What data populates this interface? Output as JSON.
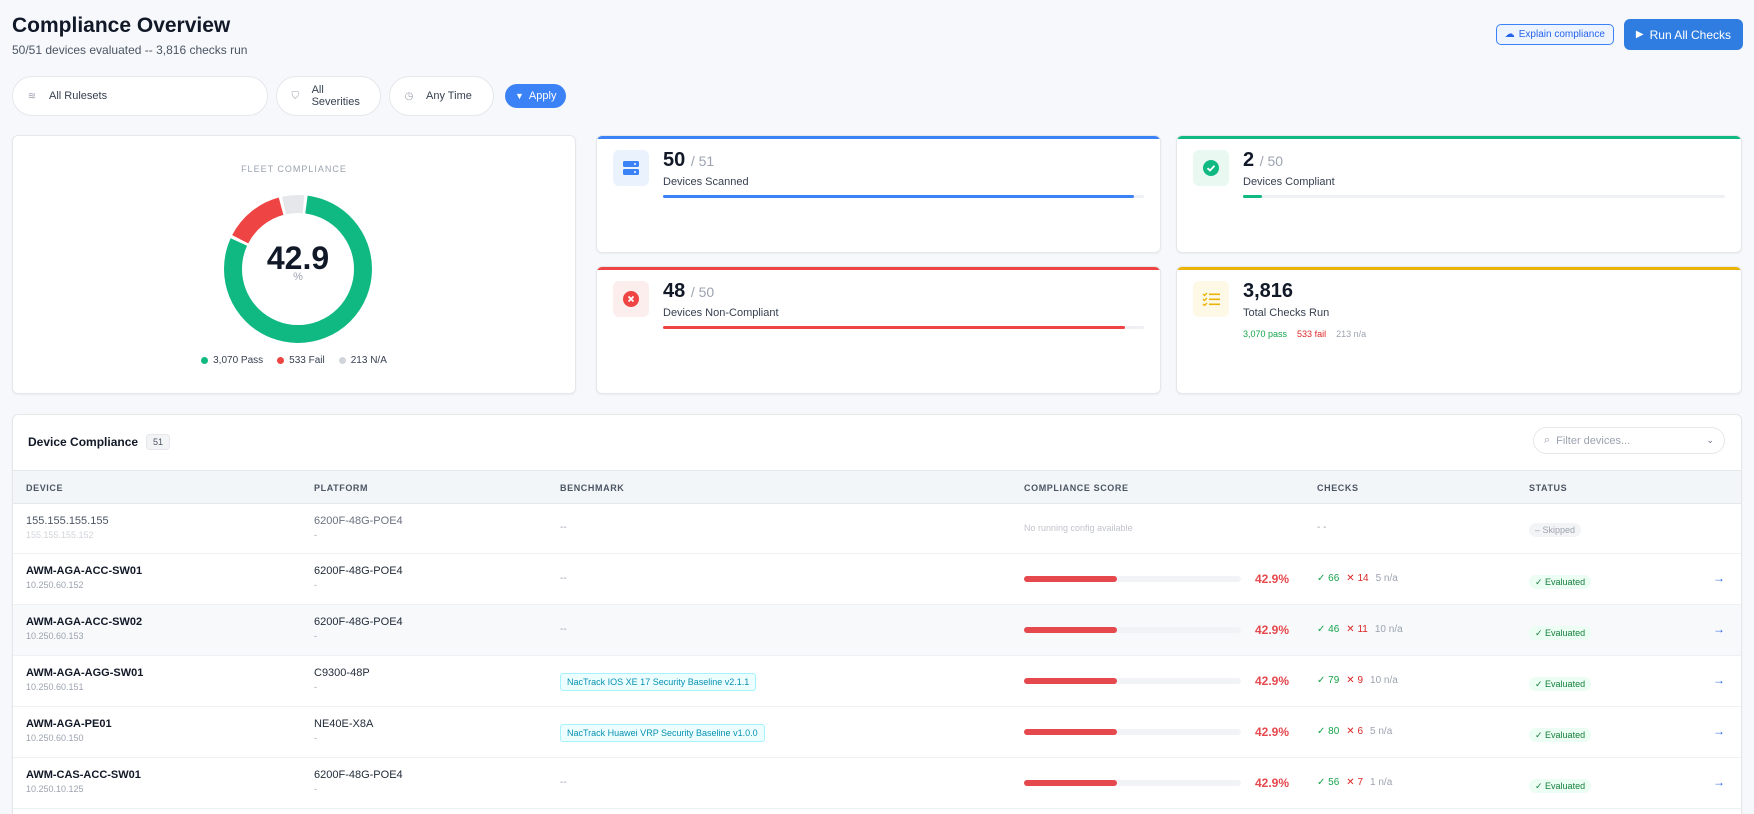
{
  "header": {
    "title": "Compliance Overview",
    "subtitle": "50/51 devices evaluated -- 3,816 checks run",
    "explain_label": "Explain compliance",
    "run_label": "Run All Checks"
  },
  "filters": {
    "ruleset": "All Rulesets",
    "severity": "All Severities",
    "time": "Any Time",
    "apply_label": "Apply"
  },
  "fleet": {
    "label": "FLEET COMPLIANCE",
    "value": "42.9",
    "unit": "%",
    "pass_count": 3070,
    "fail_count": 533,
    "na_count": 213,
    "legend": {
      "pass": "3,070 Pass",
      "fail": "533 Fail",
      "na": "213 N/A"
    },
    "colors": {
      "pass": "#10b981",
      "fail": "#ef4444",
      "na": "#e5e7eb"
    }
  },
  "stats": {
    "scanned": {
      "value": "50",
      "total": "/ 51",
      "label": "Devices Scanned",
      "fraction": 0.98,
      "color": "#3b82f6"
    },
    "compliant": {
      "value": "2",
      "total": "/ 50",
      "label": "Devices Compliant",
      "fraction": 0.04,
      "color": "#10b981"
    },
    "noncompliant": {
      "value": "48",
      "total": "/ 50",
      "label": "Devices Non-Compliant",
      "fraction": 0.96,
      "color": "#ef4444"
    },
    "checks": {
      "value": "3,816",
      "label": "Total Checks Run",
      "pass": "3,070 pass",
      "fail": "533 fail",
      "na": "213 n/a",
      "color": "#eab308"
    }
  },
  "table": {
    "title": "Device Compliance",
    "count": "51",
    "filter_placeholder": "Filter devices...",
    "columns": {
      "device": "DEVICE",
      "platform": "PLATFORM",
      "benchmark": "BENCHMARK",
      "score": "COMPLIANCE SCORE",
      "checks": "CHECKS",
      "status": "STATUS"
    },
    "rows": [
      {
        "name": "155.155.155.155",
        "ip": "155.155.155.152",
        "platform": "6200F-48G-POE4",
        "platform_sub": "-",
        "benchmark": "--",
        "score_text": "No running config available",
        "checks_text": "- -",
        "status": "– Skipped"
      },
      {
        "name": "AWM-AGA-ACC-SW01",
        "ip": "10.250.60.152",
        "platform": "6200F-48G-POE4",
        "platform_sub": "-",
        "benchmark": "--",
        "score": "42.9%",
        "score_fraction": 0.429,
        "pass": "66",
        "fail": "14",
        "na": "5 n/a",
        "status": "Evaluated"
      },
      {
        "name": "AWM-AGA-ACC-SW02",
        "ip": "10.250.60.153",
        "platform": "6200F-48G-POE4",
        "platform_sub": "-",
        "benchmark": "--",
        "score": "42.9%",
        "score_fraction": 0.429,
        "pass": "46",
        "fail": "11",
        "na": "10 n/a",
        "status": "Evaluated"
      },
      {
        "name": "AWM-AGA-AGG-SW01",
        "ip": "10.250.60.151",
        "platform": "C9300-48P",
        "platform_sub": "-",
        "benchmark": "NacTrack IOS XE 17 Security Baseline v2.1.1",
        "score": "42.9%",
        "score_fraction": 0.429,
        "pass": "79",
        "fail": "9",
        "na": "10 n/a",
        "status": "Evaluated"
      },
      {
        "name": "AWM-AGA-PE01",
        "ip": "10.250.60.150",
        "platform": "NE40E-X8A",
        "platform_sub": "-",
        "benchmark": "NacTrack Huawei VRP Security Baseline v1.0.0",
        "score": "42.9%",
        "score_fraction": 0.429,
        "pass": "80",
        "fail": "6",
        "na": "5 n/a",
        "status": "Evaluated"
      },
      {
        "name": "AWM-CAS-ACC-SW01",
        "ip": "10.250.10.125",
        "platform": "6200F-48G-POE4",
        "platform_sub": "-",
        "benchmark": "--",
        "score": "42.9%",
        "score_fraction": 0.429,
        "pass": "56",
        "fail": "7",
        "na": "1 n/a",
        "status": "Evaluated"
      }
    ]
  }
}
